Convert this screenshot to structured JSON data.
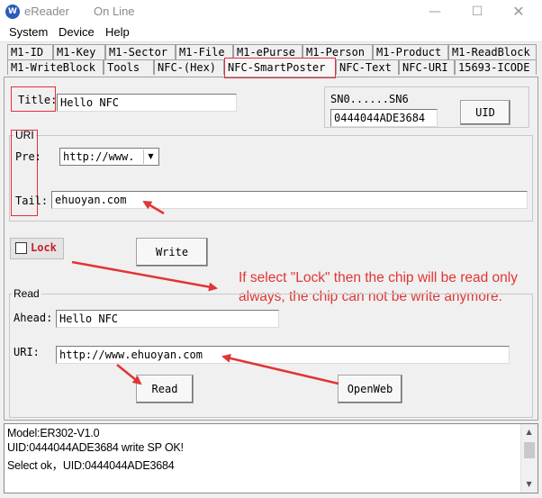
{
  "window": {
    "title": "eReader",
    "online_status": "On Line",
    "icon": "app-logo-icon"
  },
  "menu": [
    "System",
    "Device",
    "Help"
  ],
  "tabs_row1": [
    "M1-ID",
    "M1-Key",
    "M1-Sector",
    "M1-File",
    "M1-ePurse",
    "M1-Person",
    "M1-Product",
    "M1-ReadBlock"
  ],
  "tabs_row2": [
    "M1-WriteBlock",
    "Tools",
    "NFC-(Hex)",
    "NFC-SmartPoster",
    "NFC-Text",
    "NFC-URI",
    "15693-ICODE"
  ],
  "active_tab": "NFC-SmartPoster",
  "write_section": {
    "title_label": "Title:",
    "title_value": "Hello NFC",
    "sn_label": "SN0......SN6",
    "sn_value": "0444044ADE3684",
    "uid_button": "UID",
    "uri_group": "URI",
    "pre_label": "Pre:",
    "pre_value": "http://www.",
    "tail_label": "Tail:",
    "tail_value": "ehuoyan.com",
    "lock_label": "Lock",
    "lock_checked": false,
    "write_button": "Write"
  },
  "annotation": {
    "line1": "If select \"Lock\" then the chip will be read only",
    "line2": "always, the chip can not be write anymore.",
    "color": "#e03535"
  },
  "read_section": {
    "group": "Read",
    "ahead_label": "Ahead:",
    "ahead_value": "Hello NFC",
    "uri_label": "URI:",
    "uri_value": "http://www.ehuoyan.com",
    "read_button": "Read",
    "openweb_button": "OpenWeb"
  },
  "log": [
    "Model:ER302-V1.0",
    " UID:0444044ADE3684 write SP OK!",
    "Select ok，UID:0444044ADE3684"
  ]
}
